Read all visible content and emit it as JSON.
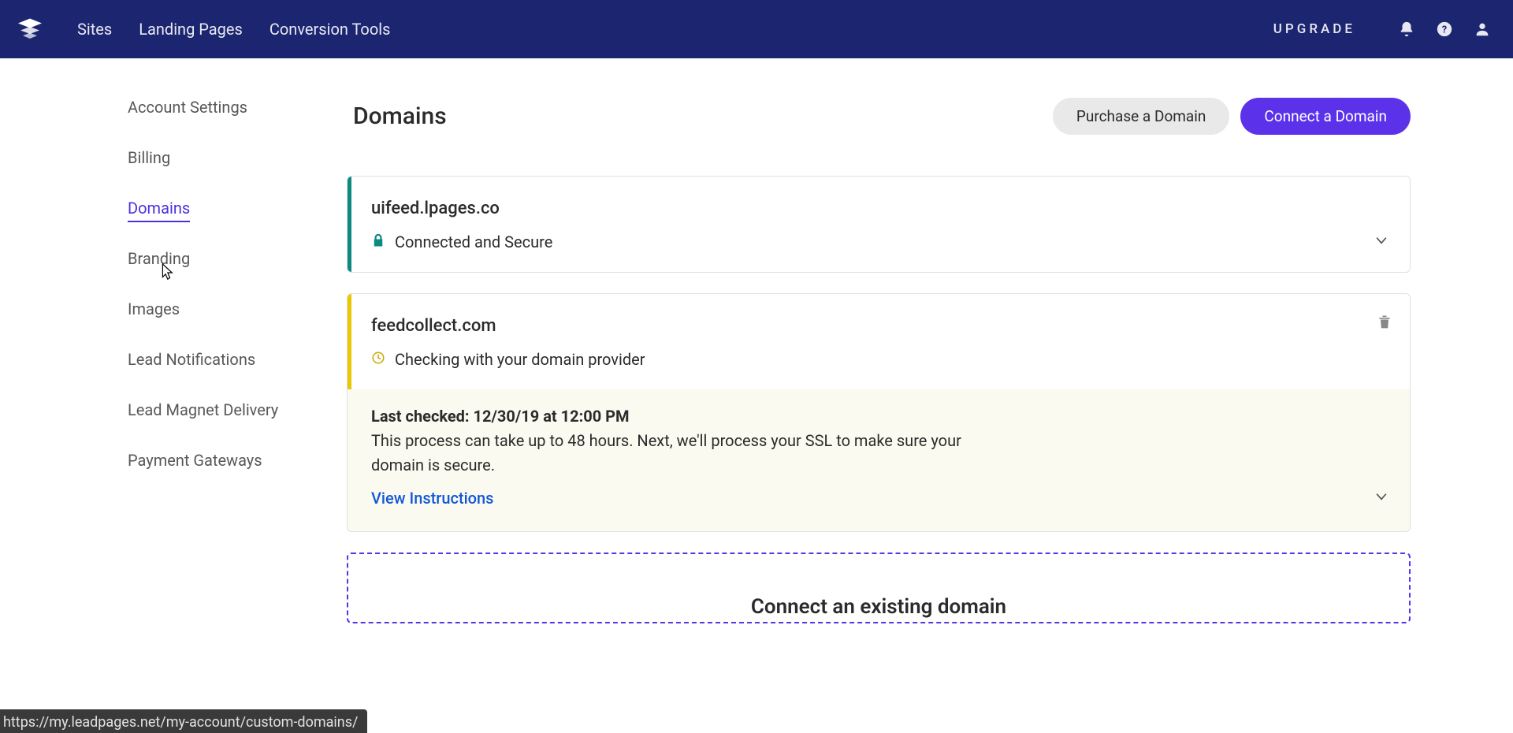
{
  "topnav": {
    "items": [
      "Sites",
      "Landing Pages",
      "Conversion Tools"
    ],
    "upgrade": "UPGRADE"
  },
  "sidebar": {
    "items": [
      "Account Settings",
      "Billing",
      "Domains",
      "Branding",
      "Images",
      "Lead Notifications",
      "Lead Magnet Delivery",
      "Payment Gateways"
    ],
    "active_index": 2
  },
  "page": {
    "title": "Domains",
    "purchase_btn": "Purchase a Domain",
    "connect_btn": "Connect a Domain"
  },
  "domains": [
    {
      "name": "uifeed.lpages.co",
      "status_text": "Connected and Secure"
    },
    {
      "name": "feedcollect.com",
      "status_text": "Checking with your domain provider",
      "details": {
        "last_checked_label": "Last checked:",
        "last_checked_value": "12/30/19 at 12:00 PM",
        "description": "This process can take up to 48 hours. Next, we'll process your SSL to make sure your domain is secure.",
        "view_instructions": "View Instructions"
      }
    }
  ],
  "connect_box": {
    "title": "Connect an existing domain"
  },
  "status_url": "https://my.leadpages.net/my-account/custom-domains/"
}
